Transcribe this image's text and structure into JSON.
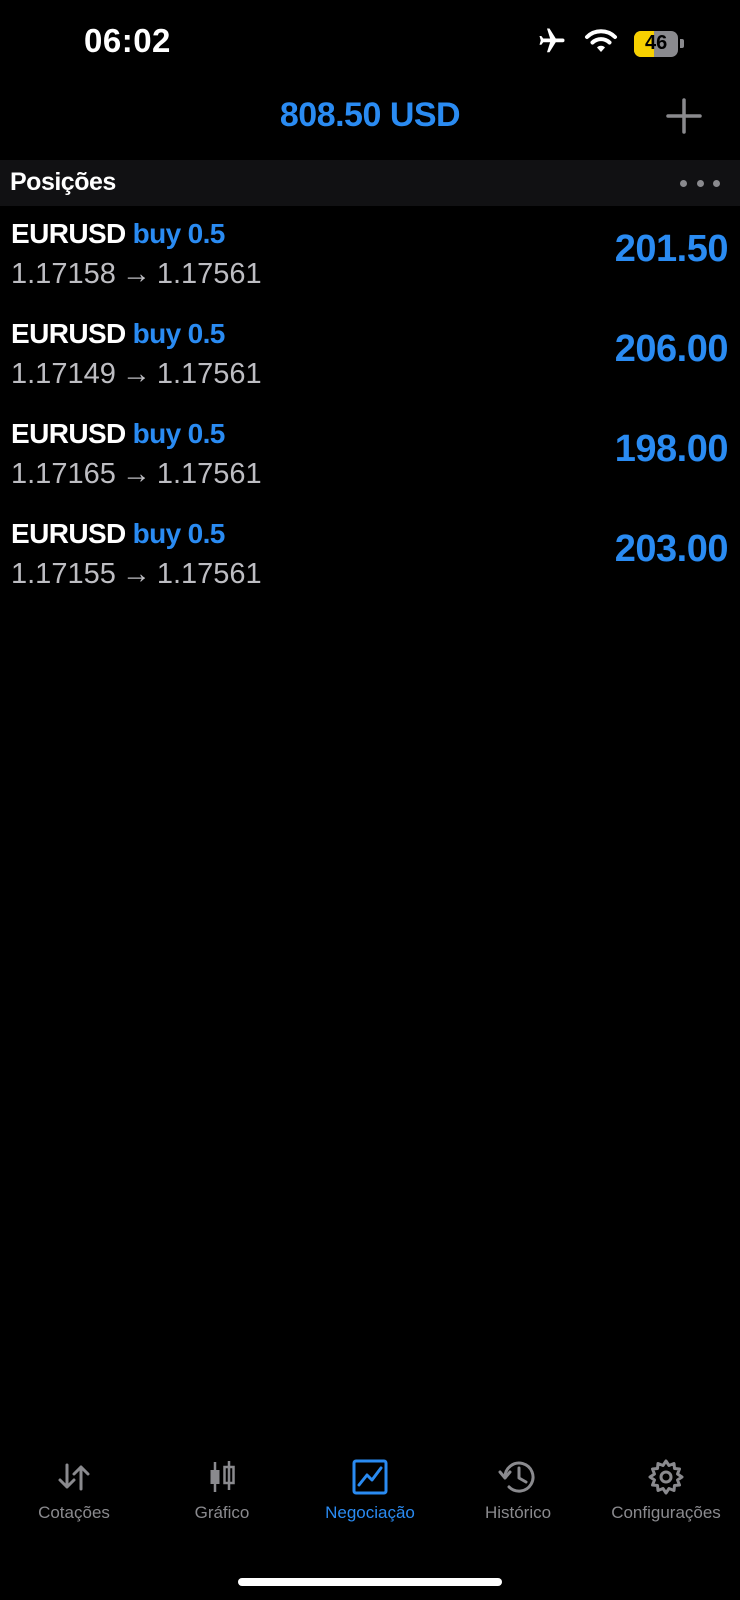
{
  "status_bar": {
    "time": "06:02",
    "battery_level": "46",
    "battery_fraction": 0.46,
    "icons": [
      "airplane-icon",
      "wifi-icon",
      "battery-icon"
    ]
  },
  "header": {
    "balance": "808.50 USD",
    "add_icon": "plus-icon"
  },
  "section": {
    "title": "Posições",
    "more_icon": "ellipsis-icon"
  },
  "positions": [
    {
      "symbol": "EURUSD",
      "type": "buy",
      "volume": "0.5",
      "open_price": "1.17158",
      "arrow": "→",
      "current_price": "1.17561",
      "profit": "201.50"
    },
    {
      "symbol": "EURUSD",
      "type": "buy",
      "volume": "0.5",
      "open_price": "1.17149",
      "arrow": "→",
      "current_price": "1.17561",
      "profit": "206.00"
    },
    {
      "symbol": "EURUSD",
      "type": "buy",
      "volume": "0.5",
      "open_price": "1.17165",
      "arrow": "→",
      "current_price": "1.17561",
      "profit": "198.00"
    },
    {
      "symbol": "EURUSD",
      "type": "buy",
      "volume": "0.5",
      "open_price": "1.17155",
      "arrow": "→",
      "current_price": "1.17561",
      "profit": "203.00"
    }
  ],
  "tabs": [
    {
      "label": "Cotações",
      "icon": "quotes-icon",
      "active": false
    },
    {
      "label": "Gráfico",
      "icon": "chart-icon",
      "active": false
    },
    {
      "label": "Negociação",
      "icon": "trade-icon",
      "active": true
    },
    {
      "label": "Histórico",
      "icon": "history-icon",
      "active": false
    },
    {
      "label": "Configurações",
      "icon": "settings-icon",
      "active": false
    }
  ],
  "colors": {
    "accent": "#2a8bf2",
    "background": "#000000",
    "inactive": "#8a8a8e",
    "battery": "#f7d000"
  }
}
